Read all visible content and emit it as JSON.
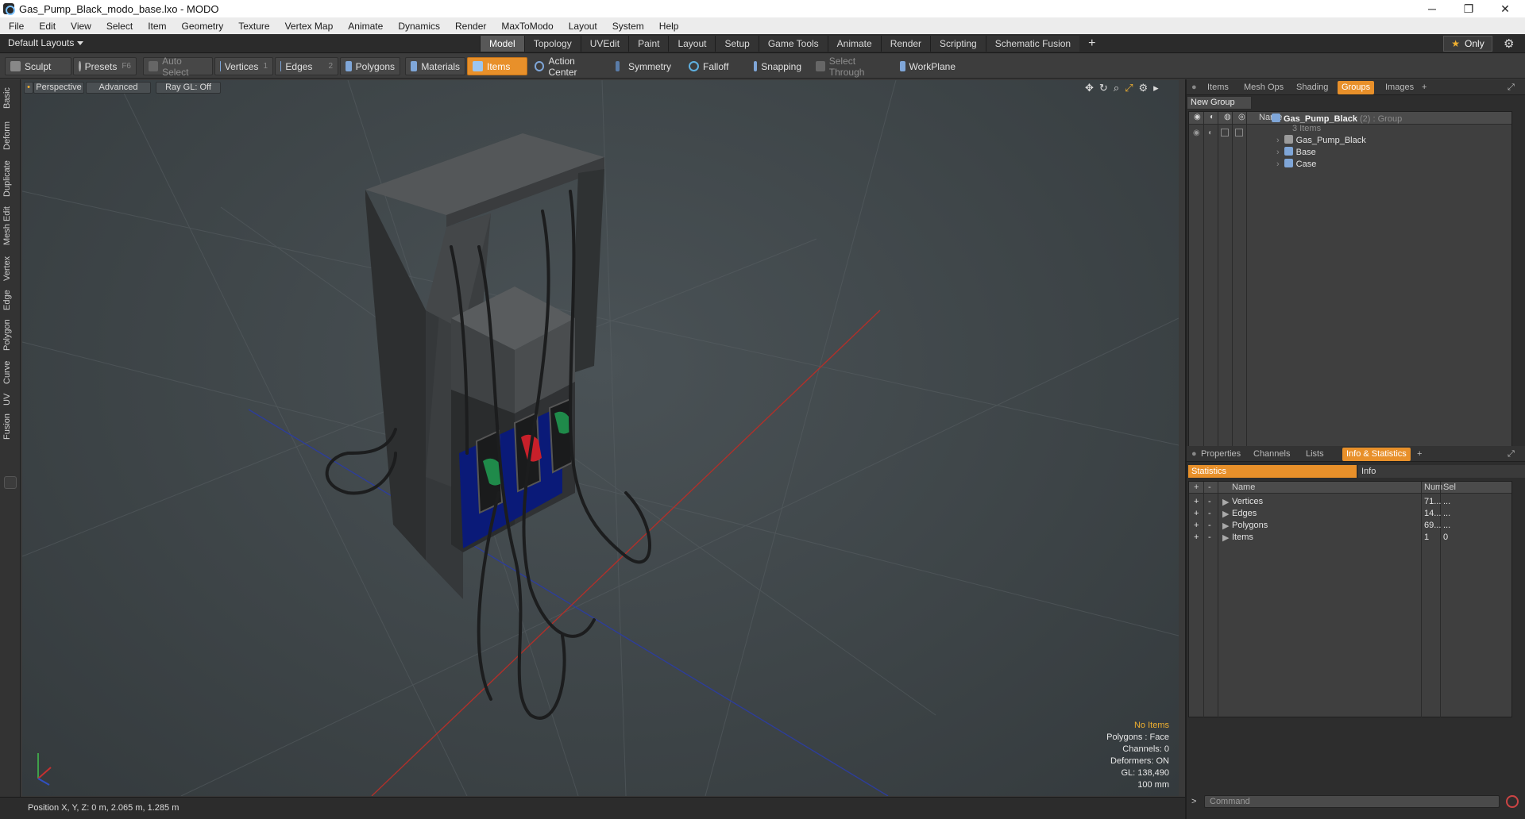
{
  "window": {
    "title": "Gas_Pump_Black_modo_base.lxo - MODO",
    "controls": [
      "─",
      "❐",
      "✕"
    ]
  },
  "menu": [
    "File",
    "Edit",
    "View",
    "Select",
    "Item",
    "Geometry",
    "Texture",
    "Vertex Map",
    "Animate",
    "Dynamics",
    "Render",
    "MaxToModo",
    "Layout",
    "System",
    "Help"
  ],
  "layouts": {
    "label": "Default Layouts"
  },
  "mode_tabs": [
    {
      "label": "Model",
      "active": true
    },
    {
      "label": "Topology"
    },
    {
      "label": "UVEdit"
    },
    {
      "label": "Paint"
    },
    {
      "label": "Layout"
    },
    {
      "label": "Setup"
    },
    {
      "label": "Game Tools"
    },
    {
      "label": "Animate"
    },
    {
      "label": "Render"
    },
    {
      "label": "Scripting"
    },
    {
      "label": "Schematic Fusion"
    }
  ],
  "only_label": "Only",
  "toolbar": {
    "sculpt": "Sculpt",
    "presets": "Presets",
    "presets_key": "F6",
    "auto_select": "Auto Select",
    "vertices": "Vertices",
    "vertices_key": "1",
    "edges": "Edges",
    "edges_key": "2",
    "polygons": "Polygons",
    "materials": "Materials",
    "items": "Items",
    "action_center": "Action Center",
    "symmetry": "Symmetry",
    "falloff": "Falloff",
    "snapping": "Snapping",
    "select_through": "Select Through",
    "workplane": "WorkPlane"
  },
  "left_tabs": [
    "Basic",
    "Deform",
    "Duplicate",
    "Mesh Edit",
    "Vertex",
    "Edge",
    "Polygon",
    "Curve",
    "UV",
    "Fusion"
  ],
  "viewport": {
    "view": "Perspective",
    "shading": "Advanced",
    "raygl": "Ray GL: Off",
    "info": {
      "no_items": "No Items",
      "polygons": "Polygons : Face",
      "channels": "Channels: 0",
      "deformers": "Deformers: ON",
      "gl": "GL: 138,490",
      "scale": "100 mm"
    }
  },
  "status": {
    "position": "Position X, Y, Z:  0 m, 2.065 m, 1.285 m"
  },
  "panel_top": {
    "tabs": [
      "Items",
      "Mesh Ops",
      "Shading",
      "Groups",
      "Images"
    ],
    "active": "Groups",
    "new_group": "New Group",
    "name_header": "Name",
    "group": {
      "name": "Gas_Pump_Black",
      "suffix": "(2) : Group",
      "count": "3 Items"
    },
    "children": [
      "Gas_Pump_Black",
      "Base",
      "Case"
    ]
  },
  "panel_bottom": {
    "tabs": [
      "Properties",
      "Channels",
      "Lists",
      "Info & Statistics"
    ],
    "active": "Info & Statistics",
    "subtabs": [
      "Statistics",
      "Info"
    ],
    "headers": {
      "name": "Name",
      "num": "Num",
      "sel": "Sel"
    },
    "rows": [
      {
        "name": "Vertices",
        "num": "71...",
        "sel": "..."
      },
      {
        "name": "Edges",
        "num": "14...",
        "sel": "..."
      },
      {
        "name": "Polygons",
        "num": "69...",
        "sel": "..."
      },
      {
        "name": "Items",
        "num": "1",
        "sel": "0"
      }
    ]
  },
  "command": {
    "placeholder": "Command"
  },
  "colors": {
    "accent": "#e8902a",
    "nozzle_green": "#1f8a4a",
    "nozzle_red": "#c8202a",
    "panel_blue": "#0a1a78"
  }
}
